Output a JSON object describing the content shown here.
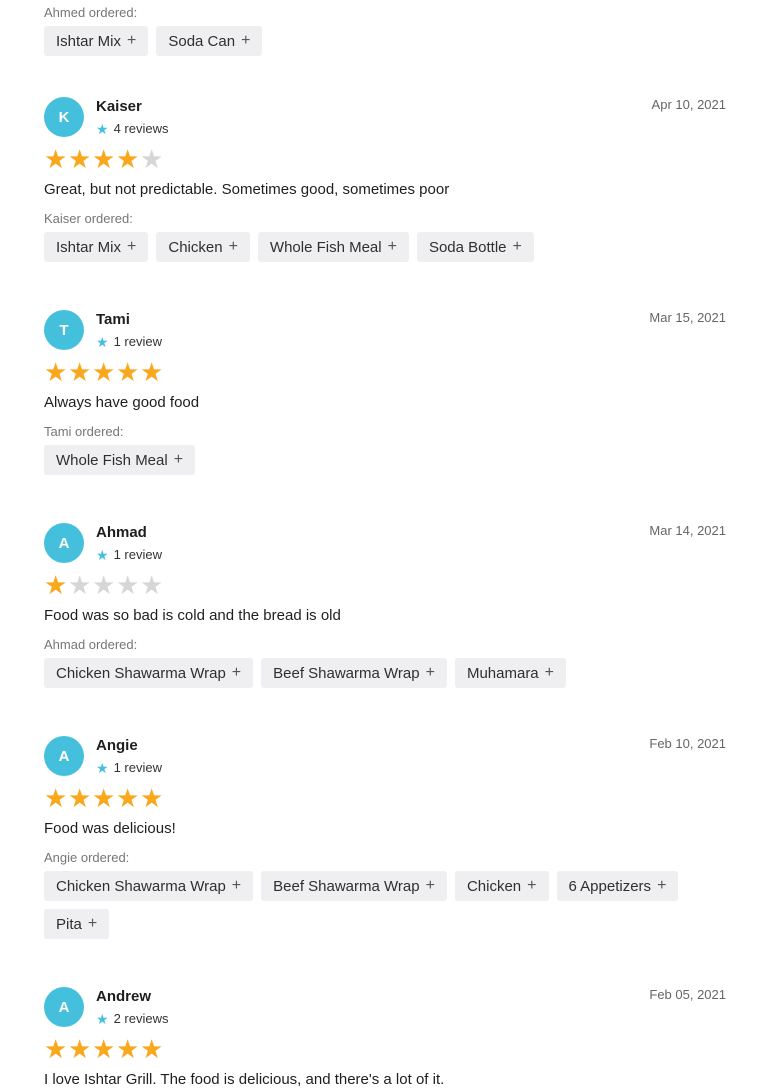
{
  "top_order": {
    "label": "Ahmed ordered:",
    "items": [
      "Ishtar Mix",
      "Soda Can"
    ]
  },
  "plus_glyph": "+",
  "star_glyph": "★",
  "reviews": [
    {
      "initial": "K",
      "name": "Kaiser",
      "review_count": "4 reviews",
      "date": "Apr 10, 2021",
      "rating": 4,
      "text": "Great, but not predictable. Sometimes good, sometimes poor",
      "ordered_label": "Kaiser ordered:",
      "items": [
        "Ishtar Mix",
        "Chicken",
        "Whole Fish Meal",
        "Soda Bottle"
      ]
    },
    {
      "initial": "T",
      "name": "Tami",
      "review_count": "1 review",
      "date": "Mar 15, 2021",
      "rating": 5,
      "text": "Always have good food",
      "ordered_label": "Tami ordered:",
      "items": [
        "Whole Fish Meal"
      ]
    },
    {
      "initial": "A",
      "name": "Ahmad",
      "review_count": "1 review",
      "date": "Mar 14, 2021",
      "rating": 1,
      "text": "Food was so bad is cold and the bread is old",
      "ordered_label": "Ahmad ordered:",
      "items": [
        "Chicken Shawarma Wrap",
        "Beef Shawarma Wrap",
        "Muhamara"
      ]
    },
    {
      "initial": "A",
      "name": "Angie",
      "review_count": "1 review",
      "date": "Feb 10, 2021",
      "rating": 5,
      "text": "Food was delicious!",
      "ordered_label": "Angie ordered:",
      "items": [
        "Chicken Shawarma Wrap",
        "Beef Shawarma Wrap",
        "Chicken",
        "6 Appetizers",
        "Pita"
      ]
    },
    {
      "initial": "A",
      "name": "Andrew",
      "review_count": "2 reviews",
      "date": "Feb 05, 2021",
      "rating": 5,
      "text": "I love Ishtar Grill. The food is delicious, and there's a lot of it.",
      "ordered_label": "",
      "items": []
    }
  ],
  "colors": {
    "avatar": "#45c0dc",
    "star_on": "#f9a81e",
    "star_off": "#d6d6d6",
    "chip_bg": "#efeff1"
  }
}
